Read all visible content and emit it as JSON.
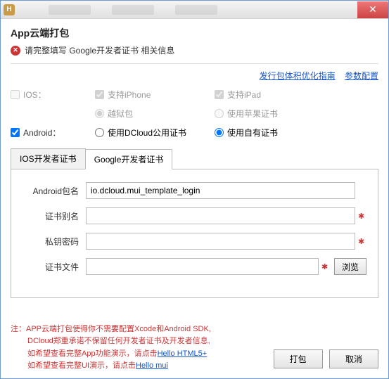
{
  "titlebar": {
    "icon_letter": "H"
  },
  "dialog": {
    "title": "App云端打包",
    "error_msg": "请完整填写 Google开发者证书 相关信息"
  },
  "links": {
    "optimize_guide": "发行包体积优化指南",
    "param_config": "参数配置"
  },
  "platforms": {
    "ios_label": "IOS：",
    "iphone_label": "支持iPhone",
    "ipad_label": "支持iPad",
    "jailbreak_label": "越狱包",
    "apple_cert_label": "使用苹果证书",
    "android_label": "Android：",
    "dcloud_cert_label": "使用DCloud公用证书",
    "own_cert_label": "使用自有证书"
  },
  "tabs": {
    "ios_cert": "IOS开发者证书",
    "google_cert": "Google开发者证书"
  },
  "form": {
    "package_label": "Android包名",
    "package_value": "io.dcloud.mui_template_login",
    "alias_label": "证书别名",
    "alias_value": "",
    "pkkey_label": "私钥密码",
    "pkkey_value": "",
    "certfile_label": "证书文件",
    "certfile_value": "",
    "browse_btn": "浏览"
  },
  "note": {
    "prefix": "注：",
    "line1": "APP云端打包使得你不需要配置Xcode和Android SDK,",
    "line2": "DCloud郑重承诺不保留任何开发者证书及开发者信息,",
    "line3a": "如希望查看完整App功能演示，请点击",
    "link1": "Hello HTML5+",
    "line4a": "如希望查看完整UI演示，请点击",
    "link2": "Hello mui"
  },
  "buttons": {
    "pack": "打包",
    "cancel": "取消"
  }
}
